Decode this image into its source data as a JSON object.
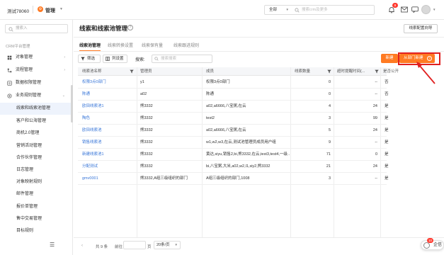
{
  "topbar": {
    "company": "测试78060",
    "module": "管理",
    "scope": "全部",
    "search_placeholder": "搜索crm及更多",
    "notification_count": "9"
  },
  "sidebar": {
    "search_placeholder": "搜索入",
    "section_title": "CRM平台管理",
    "items": [
      {
        "label": "对象管理",
        "icon": "object-icon",
        "has_arrow": true
      },
      {
        "label": "流程管理",
        "icon": "flow-icon",
        "has_arrow": true
      },
      {
        "label": "数据权限管理",
        "icon": "permission-icon",
        "has_arrow": false
      },
      {
        "label": "业务规则管理",
        "icon": "rule-icon",
        "has_arrow": true
      }
    ],
    "sub_items": [
      "线索和线索池管理",
      "客户和公海管理",
      "商机2.0管理",
      "营销活动管理",
      "合作伙伴管理",
      "日志管理",
      "对象映射规则",
      "邮件管理",
      "报价单管理",
      "售中交易管理",
      "目标规则"
    ],
    "active_sub_item": "线索和线索池管理"
  },
  "main": {
    "title": "线索和线索池管理",
    "guide_button": "线索配置向导",
    "tabs": [
      "线索池管理",
      "线索转换设置",
      "线索保有量",
      "线索跟进规则"
    ],
    "active_tab": "线索池管理",
    "toolbar": {
      "filter": "筛选",
      "columns": "列设置",
      "keyword_label": "搜索:",
      "keyword_placeholder": "搜索搜索",
      "new": "新建",
      "dept_new": "从部门新建"
    },
    "table": {
      "columns": [
        "线索池名称",
        "管理员",
        "成员",
        "线索数量",
        "超时提醒时间(...",
        "是否公开"
      ],
      "rows": [
        {
          "name": "权限3点0部门",
          "admin": "y1",
          "members": "权限3点0部门",
          "count": "0",
          "timeout": "--",
          "public": "否"
        },
        {
          "name": "陈通",
          "admin": "a02",
          "members": "陈通",
          "count": "0",
          "timeout": "--",
          "public": "否"
        },
        {
          "name": "欧田线索池1",
          "admin": "熊3332",
          "members": "a02,a6666,八宝粥,在云",
          "count": "4",
          "timeout": "24",
          "public": "是"
        },
        {
          "name": "陶色",
          "admin": "熊3332",
          "members": "test2",
          "count": "3",
          "timeout": "99",
          "public": "是"
        },
        {
          "name": "欧田线索池",
          "admin": "熊3332",
          "members": "a02,a6666,八宝粥,在云",
          "count": "5",
          "timeout": "24",
          "public": "是"
        },
        {
          "name": "销售线索池",
          "admin": "熊3332",
          "members": "w1,w2,w3,在云,测试池管理员成员用户组",
          "count": "9",
          "timeout": "--",
          "public": "是"
        },
        {
          "name": "新建线索池1",
          "admin": "熊3332",
          "members": "黄达,siyu,销售2,bi,熊3332,在云,test3,test4,一级...",
          "count": "71",
          "timeout": "0",
          "public": "是"
        },
        {
          "name": "分配测试",
          "admin": "熊3332",
          "members": "bi,八宝粥,大米,a02,w2,l1,siy2,熊3332",
          "count": "21",
          "timeout": "24",
          "public": "是"
        },
        {
          "name": "gmv0001",
          "admin": "熊3332,A组三级组织的部门",
          "members": "A组三级组织的部门,1008",
          "count": "3",
          "timeout": "--",
          "public": "是"
        }
      ]
    },
    "pagination": {
      "total": "共 9 条",
      "goto_label": "前往",
      "page_label": "页",
      "page_size": "20条/页"
    }
  },
  "floating": {
    "label": "企信",
    "badge": "10"
  },
  "colors": {
    "accent": "#ff7a22",
    "link": "#3876d8",
    "annotation": "#e02020"
  }
}
